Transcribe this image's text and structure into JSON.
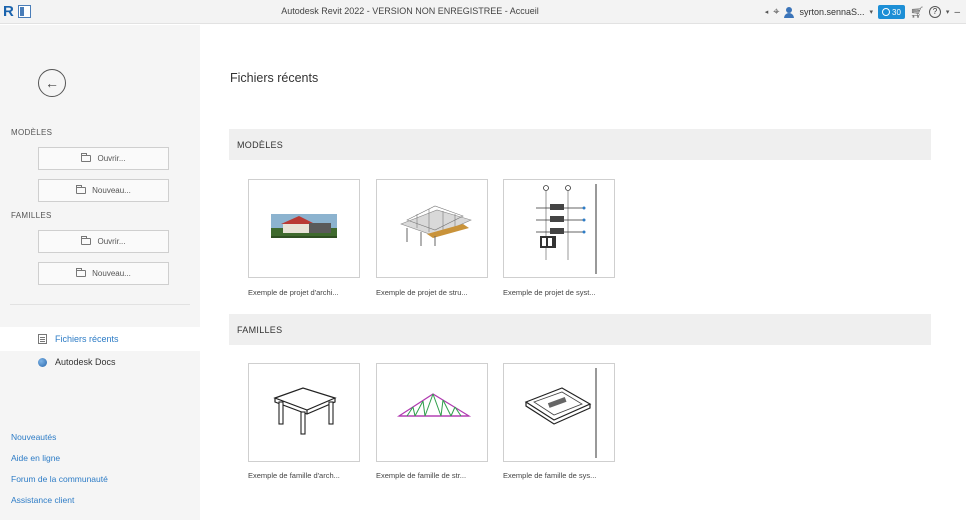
{
  "titlebar": {
    "title": "Autodesk Revit 2022 - VERSION NON ENREGISTREE - Accueil",
    "logo_letter": "R",
    "username": "syrton.sennaS...",
    "trial_days": "30",
    "icons": [
      "revit-logo-icon",
      "app-icon",
      "binoculars-icon",
      "user-icon",
      "clock-icon",
      "cart-icon",
      "help-icon",
      "minimize-icon"
    ]
  },
  "sidebar": {
    "back_glyph": "←",
    "models_label": "MODÈLES",
    "models_open": "Ouvrir...",
    "models_new": "Nouveau...",
    "families_label": "FAMILLES",
    "families_open": "Ouvrir...",
    "families_new": "Nouveau...",
    "nav_recent": "Fichiers récents",
    "nav_docs": "Autodesk Docs",
    "links": [
      "Nouveautés",
      "Aide en ligne",
      "Forum de la communauté",
      "Assistance client"
    ]
  },
  "main": {
    "page_title": "Fichiers récents",
    "models_section": "MODÈLES",
    "families_section": "FAMILLES",
    "model_cards": [
      "Exemple de projet d'archi...",
      "Exemple de projet de stru...",
      "Exemple de projet de syst..."
    ],
    "family_cards": [
      "Exemple de famille d'arch...",
      "Exemple de famille de str...",
      "Exemple de famille de sys..."
    ]
  },
  "colors": {
    "accent": "#2d7cc6",
    "sidebar_bg": "#f5f5f5",
    "section_bg": "#efefef",
    "trial_badge": "#1d8fd6"
  }
}
